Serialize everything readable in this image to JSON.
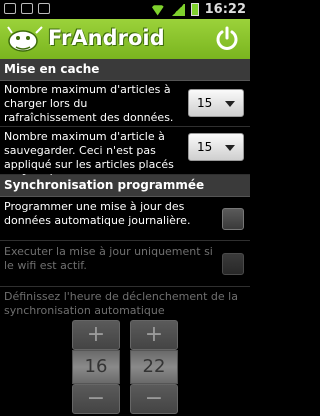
{
  "status_bar": {
    "time": "16:22"
  },
  "app_bar": {
    "title": "FrAndroid"
  },
  "sections": {
    "cache": "Mise en cache",
    "sync": "Synchronisation programmée"
  },
  "prefs": {
    "refresh_articles": {
      "label": "Nombre maximum d'articles à charger lors du rafraîchissement des données.",
      "value": "15"
    },
    "save_articles": {
      "label": "Nombre maximum d'article à sauvegarder. Ceci n'est pas appliqué sur les articles placés en favoris.",
      "value": "15"
    },
    "daily_update": {
      "label": "Programmer une mise à jour des données automatique journalière.",
      "checked": false
    },
    "wifi_only": {
      "label": "Executer la mise à jour uniquement si le wifi est actif.",
      "checked": false
    },
    "trigger_time": {
      "label": "Définissez l'heure de déclenchement de la synchronisation automatique",
      "hour": "16",
      "minute": "22",
      "plus": "+",
      "minus": "−"
    }
  }
}
